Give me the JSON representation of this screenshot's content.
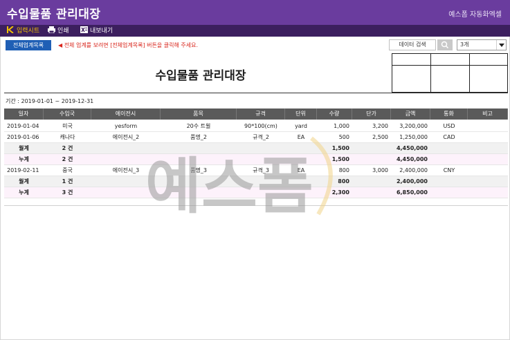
{
  "app": {
    "title": "수입물품 관리대장",
    "brand": "예스폼 자동화엑셀"
  },
  "toolbar": {
    "items": [
      {
        "label": "입력시트",
        "icon": "back-icon"
      },
      {
        "label": "인쇄",
        "icon": "print-icon"
      },
      {
        "label": "내보내기",
        "icon": "excel-icon"
      }
    ]
  },
  "actions": {
    "all_list_button": "전체업계목록",
    "notice": "◀ 전체 업계를 보려면 [전체업계목록] 버튼을 클릭해 주세요.",
    "search_button": "데이터 검색",
    "combo_value": "3개"
  },
  "document": {
    "title": "수입물품 관리대장",
    "period": "기간 : 2019-01-01 ~ 2019-12-31"
  },
  "table": {
    "columns": [
      "일자",
      "수입국",
      "에이전시",
      "품목",
      "규격",
      "단위",
      "수량",
      "단가",
      "금액",
      "통화",
      "비고"
    ],
    "rows": [
      {
        "type": "data",
        "cells": [
          "2019-01-04",
          "미국",
          "yesform",
          "20수 트윌",
          "90*100(cm)",
          "yard",
          "1,000",
          "3,200",
          "3,200,000",
          "USD",
          ""
        ]
      },
      {
        "type": "data",
        "cells": [
          "2019-01-06",
          "캐나다",
          "에이전시_2",
          "품명_2",
          "규격_2",
          "EA",
          "500",
          "2,500",
          "1,250,000",
          "CAD",
          ""
        ]
      },
      {
        "type": "sub",
        "cells": [
          "월계",
          "2 건",
          "",
          "",
          "",
          "",
          "1,500",
          "",
          "4,450,000",
          "",
          ""
        ]
      },
      {
        "type": "tot",
        "cells": [
          "누계",
          "2 건",
          "",
          "",
          "",
          "",
          "1,500",
          "",
          "4,450,000",
          "",
          ""
        ]
      },
      {
        "type": "data",
        "cells": [
          "2019-02-11",
          "중국",
          "에이전시_3",
          "품명_3",
          "규격_3",
          "EA",
          "800",
          "3,000",
          "2,400,000",
          "CNY",
          ""
        ]
      },
      {
        "type": "sub",
        "cells": [
          "월계",
          "1 건",
          "",
          "",
          "",
          "",
          "800",
          "",
          "2,400,000",
          "",
          ""
        ]
      },
      {
        "type": "tot",
        "cells": [
          "누계",
          "3 건",
          "",
          "",
          "",
          "",
          "2,300",
          "",
          "6,850,000",
          "",
          ""
        ]
      }
    ]
  },
  "watermark": {
    "text": "예스폼"
  },
  "colors": {
    "title_bar": "#6a3c9e",
    "toolbar": "#3c1f5f",
    "button": "#1f5fb5",
    "notice": "#d9261c",
    "header_row": "#5a5a5a"
  }
}
